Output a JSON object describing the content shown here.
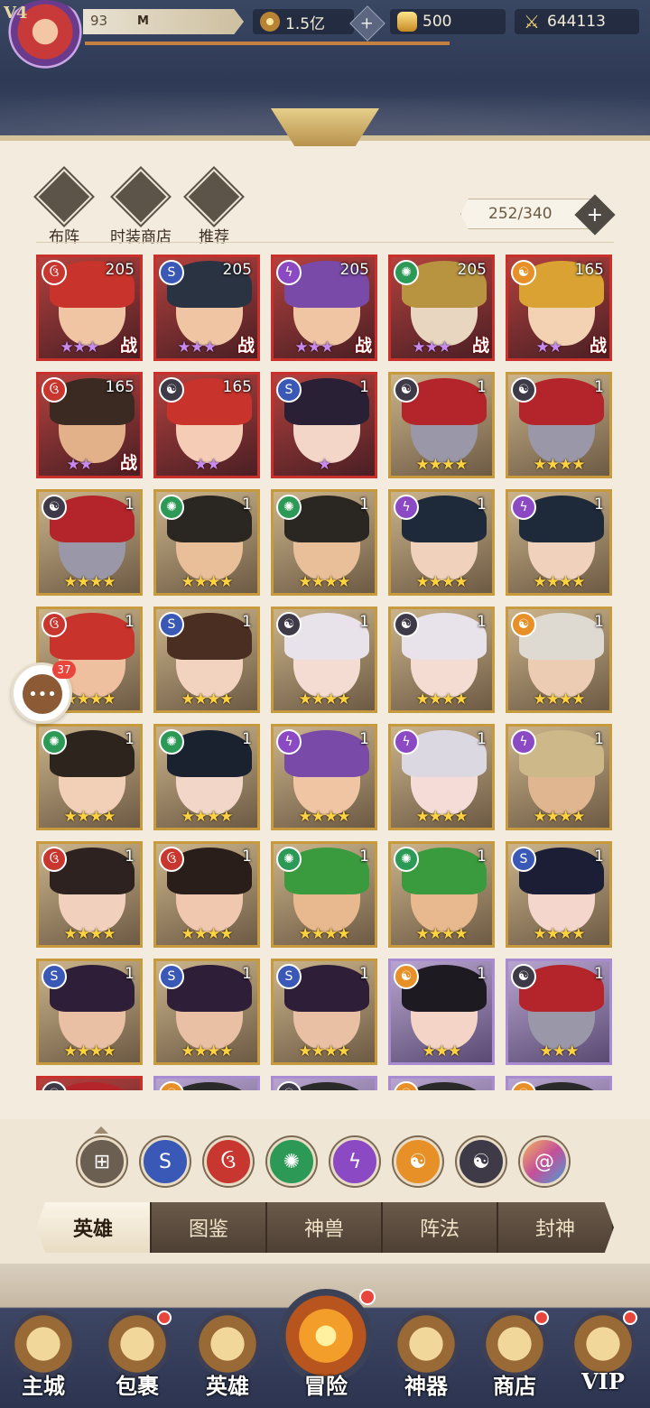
{
  "header": {
    "vip": "V4",
    "level": "93",
    "player_name": "M",
    "coins": "1.5亿",
    "gold": "500",
    "power": "644113"
  },
  "tools": [
    {
      "label": "布阵",
      "icon": "formation-icon"
    },
    {
      "label": "时装商店",
      "icon": "costume-shop-icon"
    },
    {
      "label": "推荐",
      "icon": "recommend-icon"
    }
  ],
  "hero_count": "252/340",
  "heroes": [
    {
      "element": "fire",
      "level": "205",
      "stars": "★★★",
      "star_color": "violet",
      "battle": "战",
      "frame": "red",
      "hair": "#c8332b",
      "skin": "#f0c5a4"
    },
    {
      "element": "water",
      "level": "205",
      "stars": "★★★",
      "star_color": "violet",
      "battle": "战",
      "frame": "red",
      "hair": "#2a3342",
      "skin": "#f0c5a4"
    },
    {
      "element": "thunder",
      "level": "205",
      "stars": "★★★",
      "star_color": "violet",
      "battle": "战",
      "frame": "red",
      "hair": "#7a4aa8",
      "skin": "#f0c5a4"
    },
    {
      "element": "wind",
      "level": "205",
      "stars": "★★★",
      "star_color": "violet",
      "battle": "战",
      "frame": "red",
      "hair": "#b89340",
      "skin": "#e8d6c0"
    },
    {
      "element": "light",
      "level": "165",
      "stars": "★★",
      "star_color": "violet",
      "battle": "战",
      "frame": "red",
      "hair": "#d9a232",
      "skin": "#f3d2b4"
    },
    {
      "element": "fire",
      "level": "165",
      "stars": "★★",
      "star_color": "violet",
      "battle": "战",
      "frame": "red",
      "hair": "#3a2a22",
      "skin": "#e2b18a"
    },
    {
      "element": "dark",
      "level": "165",
      "stars": "★★",
      "star_color": "violet",
      "battle": "",
      "frame": "red",
      "hair": "#c8332b",
      "skin": "#f5cdb6"
    },
    {
      "element": "water",
      "level": "1",
      "stars": "★",
      "star_color": "violet",
      "battle": "",
      "frame": "red",
      "hair": "#2a2036",
      "skin": "#f4d6c8"
    },
    {
      "element": "dark",
      "level": "1",
      "stars": "★★★★",
      "star_color": "gold",
      "battle": "",
      "frame": "gold",
      "hair": "#b3252a",
      "skin": "#9a98a8"
    },
    {
      "element": "dark",
      "level": "1",
      "stars": "★★★★",
      "star_color": "gold",
      "battle": "",
      "frame": "gold",
      "hair": "#b3252a",
      "skin": "#9a98a8"
    },
    {
      "element": "dark",
      "level": "1",
      "stars": "★★★★",
      "star_color": "gold",
      "battle": "",
      "frame": "gold",
      "hair": "#b3252a",
      "skin": "#9a98a8"
    },
    {
      "element": "wind",
      "level": "1",
      "stars": "★★★★",
      "star_color": "gold",
      "battle": "",
      "frame": "gold",
      "hair": "#2a2622",
      "skin": "#e8bf98"
    },
    {
      "element": "wind",
      "level": "1",
      "stars": "★★★★",
      "star_color": "gold",
      "battle": "",
      "frame": "gold",
      "hair": "#2a2622",
      "skin": "#e8bf98"
    },
    {
      "element": "thunder",
      "level": "1",
      "stars": "★★★★",
      "star_color": "gold",
      "battle": "",
      "frame": "gold",
      "hair": "#1e2a3a",
      "skin": "#f0d2bc"
    },
    {
      "element": "thunder",
      "level": "1",
      "stars": "★★★★",
      "star_color": "gold",
      "battle": "",
      "frame": "gold",
      "hair": "#1e2a3a",
      "skin": "#f0d2bc"
    },
    {
      "element": "fire",
      "level": "1",
      "stars": "★★★★",
      "star_color": "gold",
      "battle": "",
      "frame": "gold",
      "hair": "#c8332b",
      "skin": "#eec0a0"
    },
    {
      "element": "water",
      "level": "1",
      "stars": "★★★★",
      "star_color": "gold",
      "battle": "",
      "frame": "gold",
      "hair": "#4a2e22",
      "skin": "#f2d3c0"
    },
    {
      "element": "dark",
      "level": "1",
      "stars": "★★★★",
      "star_color": "gold",
      "battle": "",
      "frame": "gold",
      "hair": "#e8e2ea",
      "skin": "#f4dcd2"
    },
    {
      "element": "dark",
      "level": "1",
      "stars": "★★★★",
      "star_color": "gold",
      "battle": "",
      "frame": "gold",
      "hair": "#e8e2ea",
      "skin": "#f4dcd2"
    },
    {
      "element": "light",
      "level": "1",
      "stars": "★★★★",
      "star_color": "gold",
      "battle": "",
      "frame": "gold",
      "hair": "#dedad2",
      "skin": "#eccdb4"
    },
    {
      "element": "wind",
      "level": "1",
      "stars": "★★★★",
      "star_color": "gold",
      "battle": "",
      "frame": "gold",
      "hair": "#2e241e",
      "skin": "#f2d0b8"
    },
    {
      "element": "wind",
      "level": "1",
      "stars": "★★★★",
      "star_color": "gold",
      "battle": "",
      "frame": "gold",
      "hair": "#1a2230",
      "skin": "#f2d6c8"
    },
    {
      "element": "thunder",
      "level": "1",
      "stars": "★★★★",
      "star_color": "gold",
      "battle": "",
      "frame": "gold",
      "hair": "#7a4aa8",
      "skin": "#f0c5a4"
    },
    {
      "element": "thunder",
      "level": "1",
      "stars": "★★★★",
      "star_color": "gold",
      "battle": "",
      "frame": "gold",
      "hair": "#dcd8e2",
      "skin": "#f6dcd6"
    },
    {
      "element": "thunder",
      "level": "1",
      "stars": "★★★★",
      "star_color": "gold",
      "battle": "",
      "frame": "gold",
      "hair": "#cdb88a",
      "skin": "#e0b690"
    },
    {
      "element": "fire",
      "level": "1",
      "stars": "★★★★",
      "star_color": "gold",
      "battle": "",
      "frame": "gold",
      "hair": "#2e2220",
      "skin": "#f2d0be"
    },
    {
      "element": "fire",
      "level": "1",
      "stars": "★★★★",
      "star_color": "gold",
      "battle": "",
      "frame": "gold",
      "hair": "#2a1e1a",
      "skin": "#f0c8b0"
    },
    {
      "element": "wind",
      "level": "1",
      "stars": "★★★★",
      "star_color": "gold",
      "battle": "",
      "frame": "gold",
      "hair": "#3a9a3e",
      "skin": "#e8b88e"
    },
    {
      "element": "wind",
      "level": "1",
      "stars": "★★★★",
      "star_color": "gold",
      "battle": "",
      "frame": "gold",
      "hair": "#3a9a3e",
      "skin": "#e8b88e"
    },
    {
      "element": "water",
      "level": "1",
      "stars": "★★★★",
      "star_color": "gold",
      "battle": "",
      "frame": "gold",
      "hair": "#1c1e36",
      "skin": "#f4d6cc"
    },
    {
      "element": "water",
      "level": "1",
      "stars": "★★★★",
      "star_color": "gold",
      "battle": "",
      "frame": "gold",
      "hair": "#2e1e38",
      "skin": "#eac0a4"
    },
    {
      "element": "water",
      "level": "1",
      "stars": "★★★★",
      "star_color": "gold",
      "battle": "",
      "frame": "gold",
      "hair": "#2e1e38",
      "skin": "#eac0a4"
    },
    {
      "element": "water",
      "level": "1",
      "stars": "★★★★",
      "star_color": "gold",
      "battle": "",
      "frame": "gold",
      "hair": "#2e1e38",
      "skin": "#eac0a4"
    },
    {
      "element": "light",
      "level": "1",
      "stars": "★★★",
      "star_color": "gold",
      "battle": "",
      "frame": "purple",
      "hair": "#1e1a22",
      "skin": "#f4d4c6"
    },
    {
      "element": "dark",
      "level": "1",
      "stars": "★★★",
      "star_color": "gold",
      "battle": "",
      "frame": "purple",
      "hair": "#b3252a",
      "skin": "#9a98a8"
    },
    {
      "element": "dark",
      "level": "",
      "stars": "",
      "star_color": "gold",
      "battle": "",
      "frame": "red",
      "hair": "#b3252a",
      "skin": "#9a98a8"
    },
    {
      "element": "light",
      "level": "",
      "stars": "",
      "star_color": "gold",
      "battle": "",
      "frame": "purple",
      "hair": "#2a2a2a",
      "skin": "#e8c0a0"
    },
    {
      "element": "dark",
      "level": "",
      "stars": "",
      "star_color": "gold",
      "battle": "",
      "frame": "purple",
      "hair": "#2a2a2a",
      "skin": "#e8c0a0"
    },
    {
      "element": "light",
      "level": "",
      "stars": "",
      "star_color": "gold",
      "battle": "",
      "frame": "purple",
      "hair": "#2a2a2a",
      "skin": "#e8c0a0"
    },
    {
      "element": "light",
      "level": "",
      "stars": "",
      "star_color": "gold",
      "battle": "",
      "frame": "purple",
      "hair": "#2a2a2a",
      "skin": "#e8c0a0"
    }
  ],
  "chat_badge": "37",
  "element_icons": {
    "fire": "fire-element-icon",
    "water": "water-element-icon",
    "wind": "wind-element-icon",
    "thunder": "thunder-element-icon",
    "light": "light-element-icon",
    "dark": "dark-element-icon"
  },
  "element_glyphs": {
    "fire": "ઉ",
    "water": "S",
    "wind": "✺",
    "thunder": "ϟ",
    "light": "☯",
    "dark": "☯"
  },
  "element_colors": {
    "fire": "#c8372f",
    "water": "#3a58b6",
    "wind": "#2c9a56",
    "thunder": "#8b4ac4",
    "light": "#e89028",
    "dark": "#3e3a47"
  },
  "filters": [
    "all",
    "water",
    "fire",
    "wind",
    "thunder",
    "light",
    "dark",
    "chaos"
  ],
  "subtabs": [
    "英雄",
    "图鉴",
    "神兽",
    "阵法",
    "封神"
  ],
  "nav": {
    "main_city": "主城",
    "bag": "包裹",
    "heroes": "英雄",
    "adventure": "冒险",
    "artifact": "神器",
    "shop": "商店",
    "vip": "VIP"
  }
}
